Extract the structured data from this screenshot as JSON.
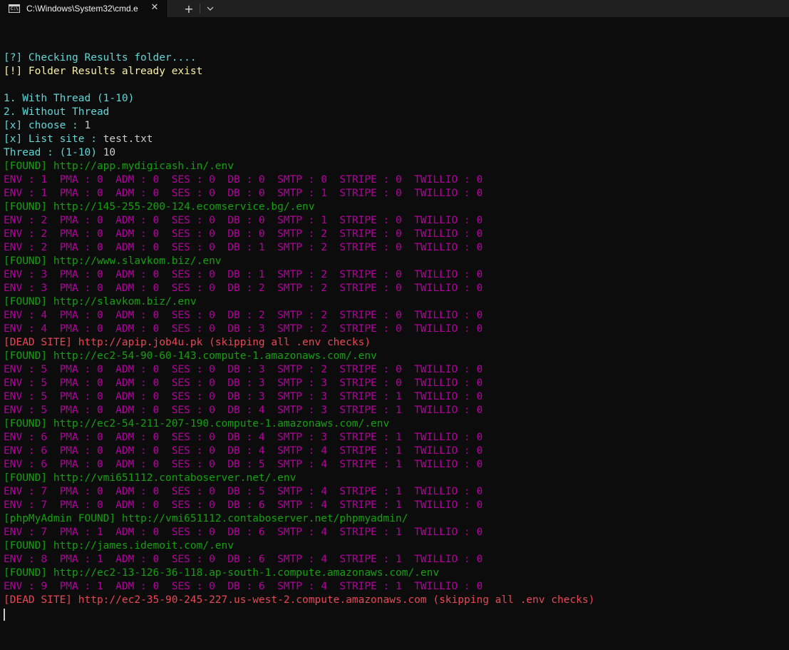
{
  "window": {
    "tab_title": "C:\\Windows\\System32\\cmd.e",
    "tab_icon_text": "C:\\",
    "close_glyph": "✕",
    "new_tab_glyph": "+"
  },
  "colors": {
    "background": "#0c0c0c",
    "cyan": "#61d6d6",
    "yellow": "#f9f1a5",
    "white": "#cccccc",
    "green": "#13a10e",
    "magenta": "#b4009e",
    "red": "#e74856"
  },
  "console": {
    "lines": [
      {
        "segments": []
      },
      {
        "segments": [
          {
            "text": "[?] Checking Results folder....",
            "color": "cyan"
          }
        ]
      },
      {
        "segments": [
          {
            "text": "[!] Folder Results already exist",
            "color": "yellow"
          }
        ]
      },
      {
        "segments": []
      },
      {
        "segments": [
          {
            "text": "1. With Thread (1-10)",
            "color": "cyan"
          }
        ]
      },
      {
        "segments": [
          {
            "text": "2. Without Thread",
            "color": "cyan"
          }
        ]
      },
      {
        "segments": [
          {
            "text": "[x] choose : ",
            "color": "cyan"
          },
          {
            "text": "1",
            "color": "white"
          }
        ]
      },
      {
        "segments": [
          {
            "text": "[x] List site : ",
            "color": "cyan"
          },
          {
            "text": "test.txt",
            "color": "white"
          }
        ]
      },
      {
        "segments": [
          {
            "text": "Thread : (1-10) ",
            "color": "cyan"
          },
          {
            "text": "10",
            "color": "white"
          }
        ]
      },
      {
        "segments": [
          {
            "text": "[FOUND] http://app.mydigicash.in/.env",
            "color": "green"
          }
        ]
      },
      {
        "segments": [
          {
            "text": "ENV : 1  PMA : 0  ADM : 0  SES : 0  DB : 0  SMTP : 0  STRIPE : 0  TWILLIO : 0",
            "color": "magenta"
          }
        ]
      },
      {
        "segments": [
          {
            "text": "ENV : 1  PMA : 0  ADM : 0  SES : 0  DB : 0  SMTP : 1  STRIPE : 0  TWILLIO : 0",
            "color": "magenta"
          }
        ]
      },
      {
        "segments": [
          {
            "text": "[FOUND] http://145-255-200-124.ecomservice.bg/.env",
            "color": "green"
          }
        ]
      },
      {
        "segments": [
          {
            "text": "ENV : 2  PMA : 0  ADM : 0  SES : 0  DB : 0  SMTP : 1  STRIPE : 0  TWILLIO : 0",
            "color": "magenta"
          }
        ]
      },
      {
        "segments": [
          {
            "text": "ENV : 2  PMA : 0  ADM : 0  SES : 0  DB : 0  SMTP : 2  STRIPE : 0  TWILLIO : 0",
            "color": "magenta"
          }
        ]
      },
      {
        "segments": [
          {
            "text": "ENV : 2  PMA : 0  ADM : 0  SES : 0  DB : 1  SMTP : 2  STRIPE : 0  TWILLIO : 0",
            "color": "magenta"
          }
        ]
      },
      {
        "segments": [
          {
            "text": "[FOUND] http://www.slavkom.biz/.env",
            "color": "green"
          }
        ]
      },
      {
        "segments": [
          {
            "text": "ENV : 3  PMA : 0  ADM : 0  SES : 0  DB : 1  SMTP : 2  STRIPE : 0  TWILLIO : 0",
            "color": "magenta"
          }
        ]
      },
      {
        "segments": [
          {
            "text": "ENV : 3  PMA : 0  ADM : 0  SES : 0  DB : 2  SMTP : 2  STRIPE : 0  TWILLIO : 0",
            "color": "magenta"
          }
        ]
      },
      {
        "segments": [
          {
            "text": "[FOUND] http://slavkom.biz/.env",
            "color": "green"
          }
        ]
      },
      {
        "segments": [
          {
            "text": "ENV : 4  PMA : 0  ADM : 0  SES : 0  DB : 2  SMTP : 2  STRIPE : 0  TWILLIO : 0",
            "color": "magenta"
          }
        ]
      },
      {
        "segments": [
          {
            "text": "ENV : 4  PMA : 0  ADM : 0  SES : 0  DB : 3  SMTP : 2  STRIPE : 0  TWILLIO : 0",
            "color": "magenta"
          }
        ]
      },
      {
        "segments": [
          {
            "text": "[DEAD SITE] http://apip.job4u.pk (skipping all .env checks)",
            "color": "red"
          }
        ]
      },
      {
        "segments": [
          {
            "text": "[FOUND] http://ec2-54-90-60-143.compute-1.amazonaws.com/.env",
            "color": "green"
          }
        ]
      },
      {
        "segments": [
          {
            "text": "ENV : 5  PMA : 0  ADM : 0  SES : 0  DB : 3  SMTP : 2  STRIPE : 0  TWILLIO : 0",
            "color": "magenta"
          }
        ]
      },
      {
        "segments": [
          {
            "text": "ENV : 5  PMA : 0  ADM : 0  SES : 0  DB : 3  SMTP : 3  STRIPE : 0  TWILLIO : 0",
            "color": "magenta"
          }
        ]
      },
      {
        "segments": [
          {
            "text": "ENV : 5  PMA : 0  ADM : 0  SES : 0  DB : 3  SMTP : 3  STRIPE : 1  TWILLIO : 0",
            "color": "magenta"
          }
        ]
      },
      {
        "segments": [
          {
            "text": "ENV : 5  PMA : 0  ADM : 0  SES : 0  DB : 4  SMTP : 3  STRIPE : 1  TWILLIO : 0",
            "color": "magenta"
          }
        ]
      },
      {
        "segments": [
          {
            "text": "[FOUND] http://ec2-54-211-207-190.compute-1.amazonaws.com/.env",
            "color": "green"
          }
        ]
      },
      {
        "segments": [
          {
            "text": "ENV : 6  PMA : 0  ADM : 0  SES : 0  DB : 4  SMTP : 3  STRIPE : 1  TWILLIO : 0",
            "color": "magenta"
          }
        ]
      },
      {
        "segments": [
          {
            "text": "ENV : 6  PMA : 0  ADM : 0  SES : 0  DB : 4  SMTP : 4  STRIPE : 1  TWILLIO : 0",
            "color": "magenta"
          }
        ]
      },
      {
        "segments": [
          {
            "text": "ENV : 6  PMA : 0  ADM : 0  SES : 0  DB : 5  SMTP : 4  STRIPE : 1  TWILLIO : 0",
            "color": "magenta"
          }
        ]
      },
      {
        "segments": [
          {
            "text": "[FOUND] http://vmi651112.contaboserver.net/.env",
            "color": "green"
          }
        ]
      },
      {
        "segments": [
          {
            "text": "ENV : 7  PMA : 0  ADM : 0  SES : 0  DB : 5  SMTP : 4  STRIPE : 1  TWILLIO : 0",
            "color": "magenta"
          }
        ]
      },
      {
        "segments": [
          {
            "text": "ENV : 7  PMA : 0  ADM : 0  SES : 0  DB : 6  SMTP : 4  STRIPE : 1  TWILLIO : 0",
            "color": "magenta"
          }
        ]
      },
      {
        "segments": [
          {
            "text": "[phpMyAdmin FOUND] http://vmi651112.contaboserver.net/phpmyadmin/",
            "color": "green"
          }
        ]
      },
      {
        "segments": [
          {
            "text": "ENV : 7  PMA : 1  ADM : 0  SES : 0  DB : 6  SMTP : 4  STRIPE : 1  TWILLIO : 0",
            "color": "magenta"
          }
        ]
      },
      {
        "segments": [
          {
            "text": "[FOUND] http://james.idemoit.com/.env",
            "color": "green"
          }
        ]
      },
      {
        "segments": [
          {
            "text": "ENV : 8  PMA : 1  ADM : 0  SES : 0  DB : 6  SMTP : 4  STRIPE : 1  TWILLIO : 0",
            "color": "magenta"
          }
        ]
      },
      {
        "segments": [
          {
            "text": "[FOUND] http://ec2-13-126-36-118.ap-south-1.compute.amazonaws.com/.env",
            "color": "green"
          }
        ]
      },
      {
        "segments": [
          {
            "text": "ENV : 9  PMA : 1  ADM : 0  SES : 0  DB : 6  SMTP : 4  STRIPE : 1  TWILLIO : 0",
            "color": "magenta"
          }
        ]
      },
      {
        "segments": [
          {
            "text": "[DEAD SITE] http://ec2-35-90-245-227.us-west-2.compute.amazonaws.com (skipping all .env checks)",
            "color": "red"
          }
        ]
      }
    ]
  }
}
